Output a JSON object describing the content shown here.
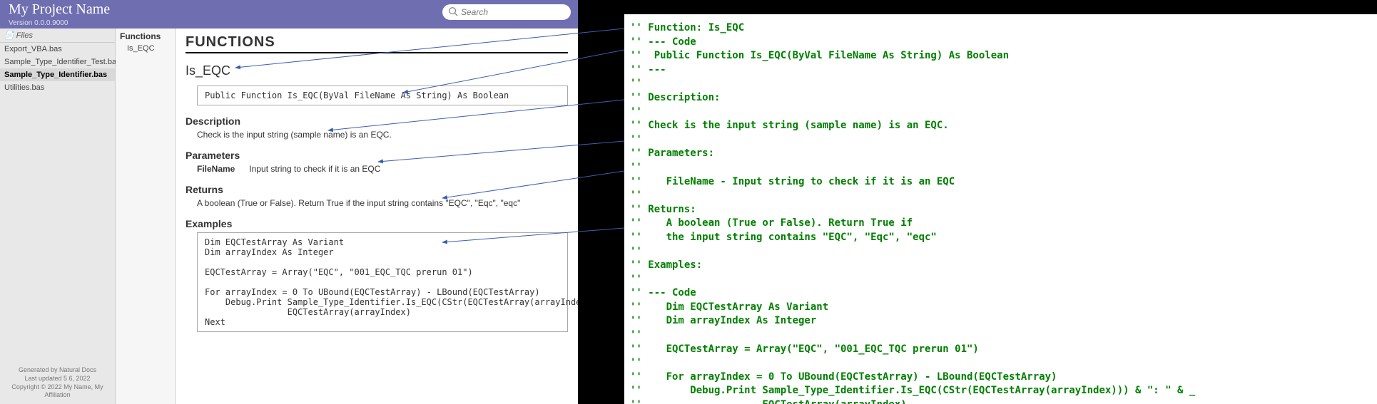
{
  "header": {
    "title": "My Project Name",
    "version": "Version 0.0.0.9000",
    "search_placeholder": "Search"
  },
  "files_sidebar": {
    "title": "Files",
    "items": [
      "Export_VBA.bas",
      "Sample_Type_Identifier_Test.bas",
      "Sample_Type_Identifier.bas",
      "Utilities.bas"
    ],
    "selected_index": 2,
    "footer1": "Generated by Natural Docs",
    "footer2": "Last updated 5 6, 2022",
    "footer3": "Copyright © 2022 My Name, My Affiliation"
  },
  "funcs_sidebar": {
    "title": "Functions",
    "items": [
      "Is_EQC"
    ]
  },
  "doc": {
    "page_title": "FUNCTIONS",
    "func_name": "Is_EQC",
    "signature": "Public Function Is_EQC(ByVal FileName As String) As Boolean",
    "desc_h": "Description",
    "desc": "Check is the input string (sample name) is an EQC.",
    "params_h": "Parameters",
    "param_name": "FileName",
    "param_desc": "Input string to check if it is an EQC",
    "returns_h": "Returns",
    "returns": "A boolean (True or False). Return True if the input string contains \"EQC\", \"Eqc\", \"eqc\"",
    "examples_h": "Examples",
    "example_code": "Dim EQCTestArray As Variant\nDim arrayIndex As Integer\n\nEQCTestArray = Array(\"EQC\", \"001_EQC_TQC prerun 01\")\n\nFor arrayIndex = 0 To UBound(EQCTestArray) - LBound(EQCTestArray)\n    Debug.Print Sample_Type_Identifier.Is_EQC(CStr(EQCTestArray(arrayIndex))) & \": \" & _\n                EQCTestArray(arrayIndex)\nNext"
  },
  "source_code": "'' Function: Is_EQC\n'' --- Code\n''  Public Function Is_EQC(ByVal FileName As String) As Boolean\n'' ---\n''\n'' Description:\n''\n'' Check is the input string (sample name) is an EQC.\n''\n'' Parameters:\n''\n''    FileName - Input string to check if it is an EQC\n''\n'' Returns:\n''    A boolean (True or False). Return True if\n''    the input string contains \"EQC\", \"Eqc\", \"eqc\"\n''\n'' Examples:\n''\n'' --- Code\n''    Dim EQCTestArray As Variant\n''    Dim arrayIndex As Integer\n''\n''    EQCTestArray = Array(\"EQC\", \"001_EQC_TQC prerun 01\")\n''\n''    For arrayIndex = 0 To UBound(EQCTestArray) - LBound(EQCTestArray)\n''        Debug.Print Sample_Type_Identifier.Is_EQC(CStr(EQCTestArray(arrayIndex))) & \": \" & _\n''                    EQCTestArray(arrayIndex)\n''    Next\n'' ---"
}
